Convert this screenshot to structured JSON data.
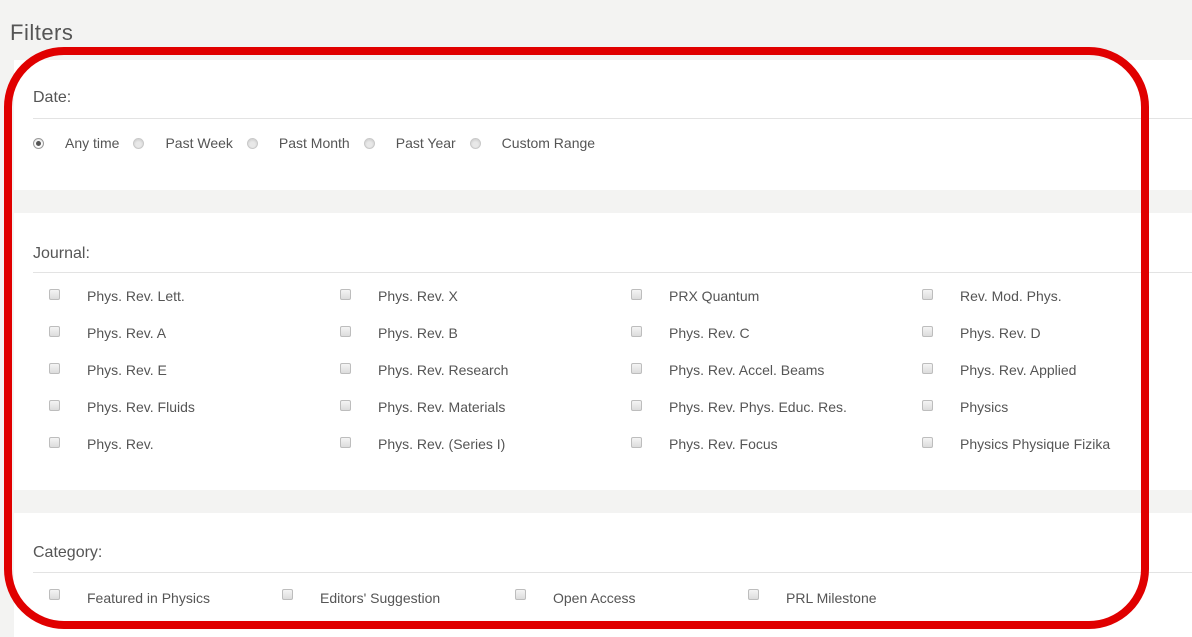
{
  "filters": {
    "title": "Filters",
    "date": {
      "label": "Date:",
      "options": [
        {
          "label": "Any time",
          "checked": true
        },
        {
          "label": "Past Week",
          "checked": false
        },
        {
          "label": "Past Month",
          "checked": false
        },
        {
          "label": "Past Year",
          "checked": false
        },
        {
          "label": "Custom Range",
          "checked": false
        }
      ]
    },
    "journal": {
      "label": "Journal:",
      "items": [
        "Phys. Rev. Lett.",
        "Phys. Rev. X",
        "PRX Quantum",
        "Rev. Mod. Phys.",
        "Phys. Rev. A",
        "Phys. Rev. B",
        "Phys. Rev. C",
        "Phys. Rev. D",
        "Phys. Rev. E",
        "Phys. Rev. Research",
        "Phys. Rev. Accel. Beams",
        "Phys. Rev. Applied",
        "Phys. Rev. Fluids",
        "Phys. Rev. Materials",
        "Phys. Rev. Phys. Educ. Res.",
        "Physics",
        "Phys. Rev.",
        "Phys. Rev. (Series I)",
        "Phys. Rev. Focus",
        "Physics Physique Fizika"
      ]
    },
    "category": {
      "label": "Category:",
      "items": [
        "Featured in Physics",
        "Editors' Suggestion",
        "Open Access",
        "PRL Milestone"
      ]
    }
  },
  "colors": {
    "highlight": "#e00000",
    "page_bg": "#f3f3f2",
    "panel_bg": "#ffffff"
  }
}
